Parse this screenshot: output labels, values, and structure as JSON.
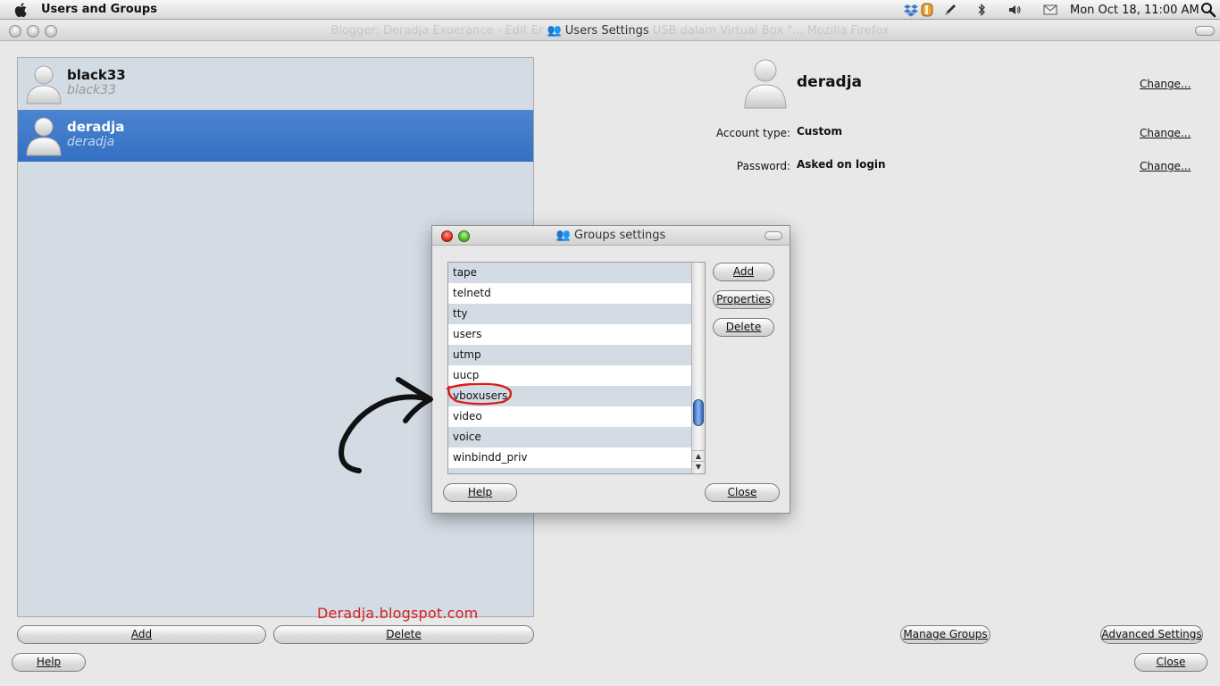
{
  "menubar": {
    "app_title": "Users and Groups",
    "clock": "Mon Oct 18, 11:00 AM",
    "icons": [
      "apple-icon",
      "dropbox-icon",
      "orange-app-icon",
      "pen-icon",
      "bluetooth-icon",
      "volume-icon",
      "mail-icon",
      "spotlight-icon"
    ]
  },
  "window": {
    "title": "Users Settings",
    "background_title": "Blogger: Deradja Exoerance - Edit Er",
    "background_title_tail": "USB dalam Virtual Box \"... Mozilla Firefox"
  },
  "users": [
    {
      "name": "black33",
      "login": "black33",
      "selected": false
    },
    {
      "name": "deradja",
      "login": "deradja",
      "selected": true
    }
  ],
  "details": {
    "name": "deradja",
    "account_type_label": "Account type:",
    "account_type_value": "Custom",
    "password_label": "Password:",
    "password_value": "Asked on login",
    "change_label": "Change..."
  },
  "groups_dialog": {
    "title": "Groups settings",
    "groups": [
      "tape",
      "telnetd",
      "tty",
      "users",
      "utmp",
      "uucp",
      "vboxusers",
      "video",
      "voice",
      "winbindd_priv"
    ],
    "highlighted_group": "vboxusers",
    "scroll_position": 0.87,
    "add_label": "Add",
    "properties_label": "Properties",
    "delete_label": "Delete",
    "help_label": "Help",
    "close_label": "Close"
  },
  "bottom": {
    "add_label": "Add",
    "delete_label": "Delete",
    "manage_groups_label": "Manage Groups",
    "advanced_settings_label": "Advanced Settings",
    "help_label": "Help",
    "close_label": "Close"
  },
  "watermark": "Deradja.blogspot.com",
  "colors": {
    "selection": "#3a78c8",
    "list_background": "#d3dbe5",
    "annotation_red": "#d8201c"
  }
}
